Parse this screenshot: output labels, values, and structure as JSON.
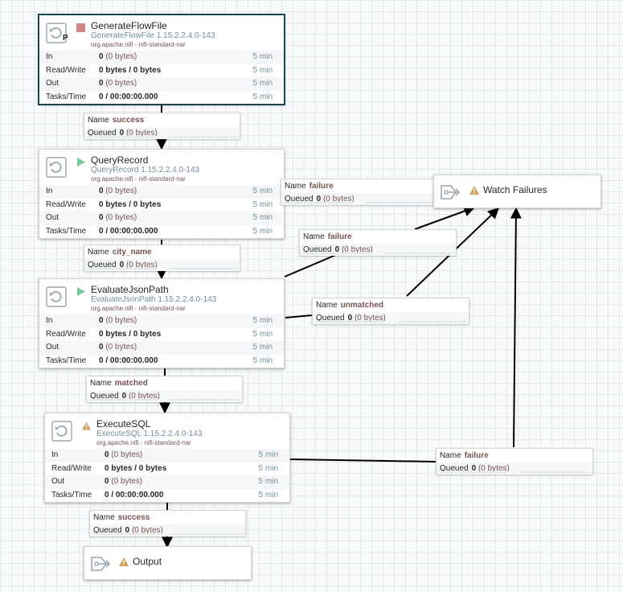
{
  "processors": [
    {
      "id": "generate",
      "name": "GenerateFlowFile",
      "type": "GenerateFlowFile 1.15.2.2.4.0-143",
      "bundle": "org.apache.nifi - nifi-standard-nar",
      "state": "stopped",
      "badge": "P",
      "selected": true,
      "stats": {
        "in_value": "0",
        "in_detail": "(0 bytes)",
        "rw": "0 bytes / 0 bytes",
        "out_value": "0",
        "out_detail": "(0 bytes)",
        "tasks": "0 / 00:00:00.000",
        "window": "5 min"
      }
    },
    {
      "id": "query",
      "name": "QueryRecord",
      "type": "QueryRecord 1.15.2.2.4.0-143",
      "bundle": "org.apache.nifi - nifi-standard-nar",
      "state": "running",
      "badge": "",
      "stats": {
        "in_value": "0",
        "in_detail": "(0 bytes)",
        "rw": "0 bytes / 0 bytes",
        "out_value": "0",
        "out_detail": "(0 bytes)",
        "tasks": "0 / 00:00:00.000",
        "window": "5 min"
      }
    },
    {
      "id": "evaluate",
      "name": "EvaluateJsonPath",
      "type": "EvaluateJsonPath 1.15.2.2.4.0-143",
      "bundle": "org.apache.nifi - nifi-standard-nar",
      "state": "running",
      "badge": "",
      "stats": {
        "in_value": "0",
        "in_detail": "(0 bytes)",
        "rw": "0 bytes / 0 bytes",
        "out_value": "0",
        "out_detail": "(0 bytes)",
        "tasks": "0 / 00:00:00.000",
        "window": "5 min"
      }
    },
    {
      "id": "execute",
      "name": "ExecuteSQL",
      "type": "ExecuteSQL 1.15.2.2.4.0-143",
      "bundle": "org.apache.nifi - nifi-standard-nar",
      "state": "invalid",
      "badge": "",
      "stats": {
        "in_value": "0",
        "in_detail": "(0 bytes)",
        "rw": "0 bytes / 0 bytes",
        "out_value": "0",
        "out_detail": "(0 bytes)",
        "tasks": "0 / 00:00:00.000",
        "window": "5 min"
      }
    }
  ],
  "stat_labels": {
    "in": "In",
    "rw": "Read/Write",
    "out": "Out",
    "tasks": "Tasks/Time"
  },
  "connection_labels": {
    "name": "Name",
    "queued": "Queued"
  },
  "connections": [
    {
      "id": "c-success-1",
      "name": "success",
      "queued_count": "0",
      "queued_size": "(0 bytes)"
    },
    {
      "id": "c-failure-query",
      "name": "failure",
      "queued_count": "0",
      "queued_size": "(0 bytes)"
    },
    {
      "id": "c-city",
      "name": "city_name",
      "queued_count": "0",
      "queued_size": "(0 bytes)"
    },
    {
      "id": "c-failure-eval",
      "name": "failure",
      "queued_count": "0",
      "queued_size": "(0 bytes)"
    },
    {
      "id": "c-unmatched",
      "name": "unmatched",
      "queued_count": "0",
      "queued_size": "(0 bytes)"
    },
    {
      "id": "c-matched",
      "name": "matched",
      "queued_count": "0",
      "queued_size": "(0 bytes)"
    },
    {
      "id": "c-failure-exec",
      "name": "failure",
      "queued_count": "0",
      "queued_size": "(0 bytes)"
    },
    {
      "id": "c-success-2",
      "name": "success",
      "queued_count": "0",
      "queued_size": "(0 bytes)"
    }
  ],
  "ports": [
    {
      "id": "watch",
      "name": "Watch Failures",
      "icon": "output-port-icon",
      "warning": true
    },
    {
      "id": "output",
      "name": "Output",
      "icon": "output-port-icon",
      "warning": true
    }
  ],
  "colors": {
    "stopped": "#d18686",
    "running": "#7dc7a0",
    "warning": "#cf9f5d",
    "selected_border": "#1b4552",
    "link": "#728e9b",
    "value": "#775351",
    "edge": "#000000"
  }
}
